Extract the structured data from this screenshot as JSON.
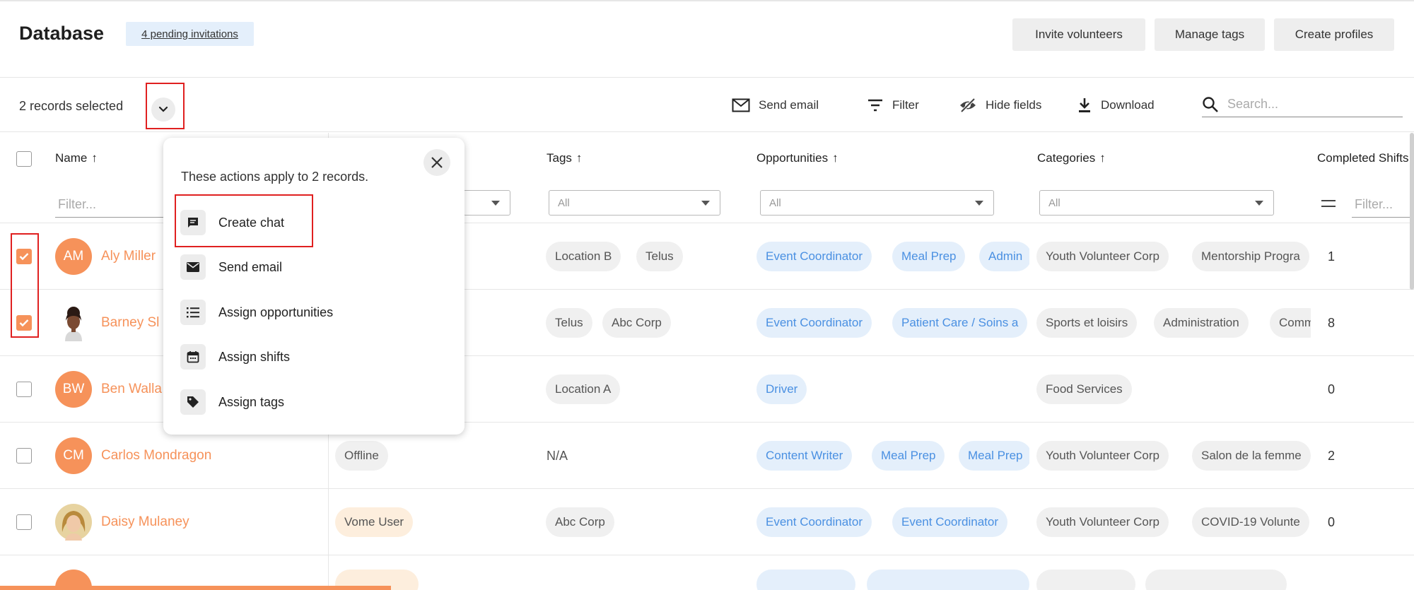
{
  "header": {
    "title": "Database",
    "pending_invitations": "4 pending invitations",
    "buttons": {
      "invite": "Invite volunteers",
      "manage_tags": "Manage tags",
      "create_profiles": "Create profiles"
    }
  },
  "toolbar": {
    "selected": "2 records selected",
    "send_email": "Send email",
    "filter": "Filter",
    "hide_fields": "Hide fields",
    "download": "Download",
    "search_placeholder": "Search..."
  },
  "columns": {
    "name": "Name",
    "tags": "Tags",
    "opportunities": "Opportunities",
    "categories": "Categories",
    "completed_shifts": "Completed Shifts"
  },
  "filters": {
    "name_placeholder": "Filter...",
    "all": "All",
    "shifts_placeholder": "Filter..."
  },
  "rows": [
    {
      "initials": "AM",
      "name": "Aly Miller",
      "checked": true,
      "status": "",
      "tags": [
        "Location B",
        "Telus"
      ],
      "opportunities": [
        "Event Coordinator",
        "Meal Prep",
        "Admin"
      ],
      "categories": [
        "Youth Volunteer Corp",
        "Mentorship Progra"
      ],
      "shifts": "1"
    },
    {
      "initials": "",
      "name": "Barney Sl",
      "checked": true,
      "status": "",
      "tags": [
        "Telus",
        "Abc Corp"
      ],
      "opportunities": [
        "Event Coordinator",
        "Patient Care / Soins a"
      ],
      "categories": [
        "Sports et loisirs",
        "Administration",
        "Comm"
      ],
      "shifts": "8"
    },
    {
      "initials": "BW",
      "name": "Ben Walla",
      "checked": false,
      "status": "",
      "tags": [
        "Location A"
      ],
      "opportunities": [
        "Driver"
      ],
      "categories": [
        "Food Services"
      ],
      "shifts": "0"
    },
    {
      "initials": "CM",
      "name": "Carlos Mondragon",
      "checked": false,
      "status": "Offline",
      "tags_text": "N/A",
      "opportunities": [
        "Content Writer",
        "Meal Prep",
        "Meal Prep"
      ],
      "categories": [
        "Youth Volunteer Corp",
        "Salon de la femme"
      ],
      "shifts": "2"
    },
    {
      "initials": "",
      "name": "Daisy Mulaney",
      "checked": false,
      "status": "Vome User",
      "tags": [
        "Abc Corp"
      ],
      "opportunities": [
        "Event Coordinator",
        "Event Coordinator"
      ],
      "categories": [
        "Youth Volunteer Corp",
        "COVID-19 Volunte"
      ],
      "shifts": "0"
    }
  ],
  "popup": {
    "note": "These actions apply to 2 records.",
    "items": [
      "Create chat",
      "Send email",
      "Assign opportunities",
      "Assign shifts",
      "Assign tags"
    ]
  },
  "colors": {
    "accent": "#f6925a",
    "blue_chip": "#e4effb",
    "highlight": "#e02020"
  }
}
